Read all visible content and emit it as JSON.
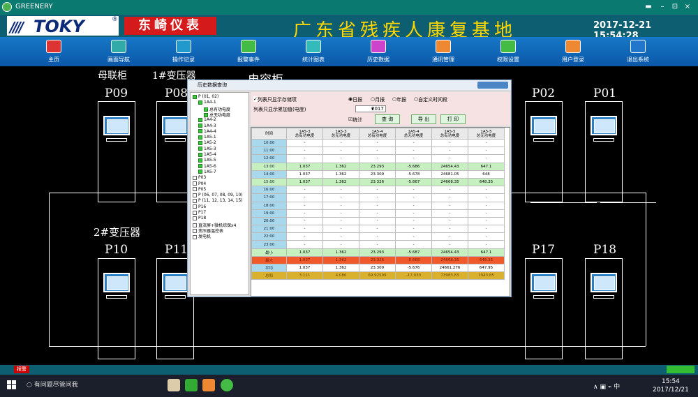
{
  "window": {
    "title": "GREENERY",
    "min": "▬",
    "restore": "–",
    "max": "⊡",
    "close": "×"
  },
  "header": {
    "brand": "TOKY",
    "brand_cn": "东崎仪表",
    "title": "广东省残疾人康复基地",
    "datetime": "2017-12-21  15:54:28"
  },
  "nav": [
    {
      "label": "主页",
      "icon": "home-icon",
      "color": "#d33"
    },
    {
      "label": "画面导航",
      "icon": "monitor-icon",
      "color": "#3aa"
    },
    {
      "label": "操作记录",
      "icon": "record-icon",
      "color": "#29c"
    },
    {
      "label": "报警事件",
      "icon": "alarm-icon",
      "color": "#4b4"
    },
    {
      "label": "统计图表",
      "icon": "chart-icon",
      "color": "#3bb"
    },
    {
      "label": "历史数据",
      "icon": "history-icon",
      "color": "#c4c"
    },
    {
      "label": "通讯管理",
      "icon": "comm-icon",
      "color": "#e83"
    },
    {
      "label": "权限设置",
      "icon": "permission-icon",
      "color": "#4b4"
    },
    {
      "label": "用户登录",
      "icon": "user-icon",
      "color": "#e83"
    },
    {
      "label": "退出系统",
      "icon": "exit-icon",
      "color": "#27c"
    }
  ],
  "sections": {
    "bus_tie": "母联柜",
    "transformer1": "1#变压器",
    "capacitor": "电容柜",
    "transformer2": "2#变压器"
  },
  "cabinets": {
    "p09": "P09",
    "p08": "P08",
    "p02": "P02",
    "p01": "P01",
    "p10": "P10",
    "p11": "P11",
    "p17": "P17",
    "p18": "P18"
  },
  "dialog": {
    "title": "历史数据查询",
    "tree": [
      {
        "label": "P (01, 02)",
        "depth": 0,
        "checked": true
      },
      {
        "label": "1A4-1",
        "depth": 1,
        "checked": true
      },
      {
        "label": "总有功电度",
        "depth": 2,
        "checked": true
      },
      {
        "label": "总无功电度",
        "depth": 2,
        "checked": true
      },
      {
        "label": "1A4-2",
        "depth": 1,
        "checked": true
      },
      {
        "label": "1A4-3",
        "depth": 1,
        "checked": true
      },
      {
        "label": "1A4-4",
        "depth": 1,
        "checked": true
      },
      {
        "label": "1A5-1",
        "depth": 1,
        "checked": true
      },
      {
        "label": "1A5-2",
        "depth": 1,
        "checked": true
      },
      {
        "label": "1A5-3",
        "depth": 1,
        "checked": true
      },
      {
        "label": "1A5-4",
        "depth": 1,
        "checked": true
      },
      {
        "label": "1A5-5",
        "depth": 1,
        "checked": true
      },
      {
        "label": "1A5-6",
        "depth": 1,
        "checked": true
      },
      {
        "label": "1A5-7",
        "depth": 1,
        "checked": true
      },
      {
        "label": "P03",
        "depth": 0,
        "checked": false
      },
      {
        "label": "P04",
        "depth": 0,
        "checked": false
      },
      {
        "label": "P05",
        "depth": 0,
        "checked": false
      },
      {
        "label": "P (06, 07, 08, 09, 10)",
        "depth": 0,
        "checked": false
      },
      {
        "label": "P (11, 12, 13, 14, 15)",
        "depth": 0,
        "checked": false
      },
      {
        "label": "P16",
        "depth": 0,
        "checked": false
      },
      {
        "label": "P17",
        "depth": 0,
        "checked": false
      },
      {
        "label": "P18",
        "depth": 0,
        "checked": false
      },
      {
        "label": "直流屏+微机综保x4",
        "depth": 0,
        "checked": false
      },
      {
        "label": "变压器温控表",
        "depth": 0,
        "checked": false
      },
      {
        "label": "发电机",
        "depth": 0,
        "checked": false
      }
    ],
    "opt_stored": "列表只显示存储项",
    "opt_accum": "列表只显示累加值(电度)",
    "radio_day": "日报",
    "radio_month": "月报",
    "radio_year": "年报",
    "radio_custom": "自定义时间段",
    "year": "2017",
    "stat": "统计",
    "btn_query": "查 询",
    "btn_export": "导 出",
    "btn_print": "打 印",
    "columns": [
      "时间",
      "1A5-3\n总有功电度",
      "1A5-3\n总无功电度",
      "1A5-4\n总有功电度",
      "1A5-4\n总无功电度",
      "1A5-5\n总有功电度",
      "1A5-5\n总无功电度"
    ],
    "rows": [
      {
        "t": "10:00",
        "v": [
          "-",
          "-",
          "-",
          "-",
          "-",
          "-"
        ],
        "cls": ""
      },
      {
        "t": "11:00",
        "v": [
          "-",
          "-",
          "-",
          "-",
          "-",
          "-"
        ],
        "cls": ""
      },
      {
        "t": "12:00",
        "v": [
          "-",
          "-",
          "-",
          "-",
          "-",
          "-"
        ],
        "cls": ""
      },
      {
        "t": "13:00",
        "v": [
          "1.037",
          "1.362",
          "23.293",
          "-5.686",
          "24654.43",
          "647.1"
        ],
        "cls": "g",
        "red": [
          3
        ]
      },
      {
        "t": "14:00",
        "v": [
          "1.037",
          "1.362",
          "23.309",
          "-5.678",
          "24681.05",
          "648"
        ],
        "cls": ""
      },
      {
        "t": "15:00",
        "v": [
          "1.037",
          "1.362",
          "23.326",
          "-5.667",
          "24668.35",
          "648.35"
        ],
        "cls": "g",
        "red": [
          2,
          4,
          5
        ]
      },
      {
        "t": "16:00",
        "v": [
          "-",
          "-",
          "-",
          "-",
          "-",
          "-"
        ],
        "cls": ""
      },
      {
        "t": "17:00",
        "v": [
          "-",
          "-",
          "-",
          "-",
          "-",
          "-"
        ],
        "cls": ""
      },
      {
        "t": "18:00",
        "v": [
          "-",
          "-",
          "-",
          "-",
          "-",
          "-"
        ],
        "cls": ""
      },
      {
        "t": "19:00",
        "v": [
          "-",
          "-",
          "-",
          "-",
          "-",
          "-"
        ],
        "cls": ""
      },
      {
        "t": "20:00",
        "v": [
          "-",
          "-",
          "-",
          "-",
          "-",
          "-"
        ],
        "cls": ""
      },
      {
        "t": "21:00",
        "v": [
          "-",
          "-",
          "-",
          "-",
          "-",
          "-"
        ],
        "cls": ""
      },
      {
        "t": "22:00",
        "v": [
          "-",
          "-",
          "-",
          "-",
          "-",
          "-"
        ],
        "cls": ""
      },
      {
        "t": "23:00",
        "v": [
          "-",
          "-",
          "-",
          "-",
          "-",
          "-"
        ],
        "cls": ""
      },
      {
        "t": "最小",
        "v": [
          "1.037",
          "1.362",
          "23.293",
          "-5.687",
          "24654.43",
          "647.1"
        ],
        "cls": "g"
      },
      {
        "t": "最大",
        "v": [
          "1.037",
          "1.362",
          "23.326",
          "-5.668",
          "24668.35",
          "648.35"
        ],
        "cls": "r"
      },
      {
        "t": "平均",
        "v": [
          "1.037",
          "1.362",
          "23.309",
          "-5.676",
          "24661.276",
          "647.95"
        ],
        "cls": ""
      },
      {
        "t": "总和",
        "v": [
          "3.111",
          "4.086",
          "69.92599",
          "-17.033",
          "73983.83",
          "1943.85"
        ],
        "cls": "o"
      }
    ]
  },
  "statusbar": {
    "alarm": "报警"
  },
  "taskbar": {
    "search": "有问题尽管问我",
    "time": "15:54",
    "date": "2017/12/21",
    "ime": "中"
  }
}
